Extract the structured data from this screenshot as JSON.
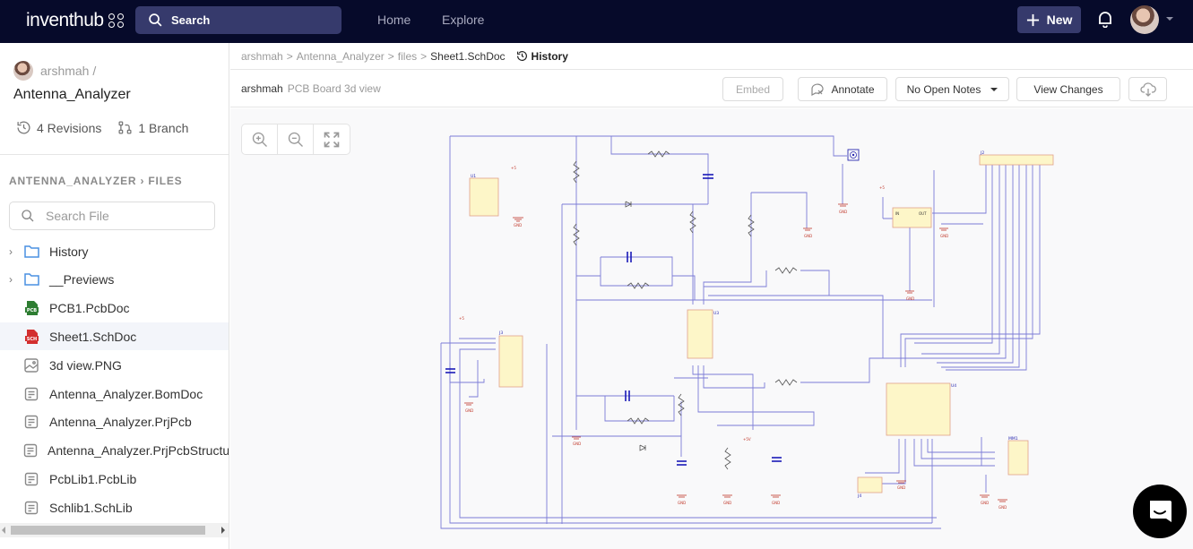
{
  "topbar": {
    "logo": "inventhub",
    "search_label": "Search",
    "nav": [
      "Home",
      "Explore"
    ],
    "new_label": "New",
    "icons": {
      "search": "search-icon",
      "new": "plus-icon",
      "bell": "bell-icon",
      "avatar": "user-avatar",
      "caret": "caret-down-icon"
    }
  },
  "sidebar": {
    "owner": "arshmah /",
    "repo": "Antenna_Analyzer",
    "revisions": "4 Revisions",
    "branches": "1 Branch",
    "files_crumb": "ANTENNA_ANALYZER › FILES",
    "search_placeholder": "Search File",
    "files": [
      {
        "name": "History",
        "type": "folder"
      },
      {
        "name": "__Previews",
        "type": "folder"
      },
      {
        "name": "PCB1.PcbDoc",
        "type": "pcb"
      },
      {
        "name": "Sheet1.SchDoc",
        "type": "sch",
        "active": true
      },
      {
        "name": "3d view.PNG",
        "type": "image"
      },
      {
        "name": "Antenna_Analyzer.BomDoc",
        "type": "doc"
      },
      {
        "name": "Antenna_Analyzer.PrjPcb",
        "type": "doc"
      },
      {
        "name": "Antenna_Analyzer.PrjPcbStructure",
        "type": "doc"
      },
      {
        "name": "PcbLib1.PcbLib",
        "type": "doc"
      },
      {
        "name": "Schlib1.SchLib",
        "type": "doc"
      }
    ]
  },
  "main": {
    "breadcrumb": [
      "arshmah",
      "Antenna_Analyzer",
      "files"
    ],
    "breadcrumb_sep": ">",
    "current_file": "Sheet1.SchDoc",
    "history_label": "History",
    "commit_author": "arshmah",
    "commit_message": "PCB Board 3d view",
    "buttons": {
      "embed": "Embed",
      "annotate": "Annotate",
      "notes": "No Open Notes",
      "view_changes": "View Changes"
    },
    "zoom_controls": [
      "zoom-in-icon",
      "zoom-out-icon",
      "fit-screen-icon"
    ],
    "schematic": {
      "components": [
        "U1",
        "R1",
        "R2",
        "R3",
        "R4",
        "R5",
        "R6",
        "R7",
        "R8",
        "R9",
        "R10",
        "R11",
        "C1",
        "C2",
        "C3",
        "C4",
        "C5",
        "C6",
        "D1",
        "D2",
        "U2",
        "U3",
        "U4",
        "J1",
        "J2",
        "J3",
        "J4",
        "MM1"
      ],
      "labels": {
        "gnd": "GND",
        "vcc": "+5",
        "u2_in": "IN",
        "u2_out": "OUT",
        "u2_gnd": "GND",
        "plus5v": "+5V"
      },
      "wire_color": "#7b7bd6",
      "part_fill": "#fdf6c8",
      "part_border": "#e0a08a",
      "ground_color": "#c0392b"
    }
  },
  "colors": {
    "topbar_bg": "#060a2a",
    "accent_btn": "#363a6c",
    "pcb_icon": "#2e7d32",
    "sch_icon": "#d32f2f",
    "folder_icon": "#4a90e2"
  }
}
